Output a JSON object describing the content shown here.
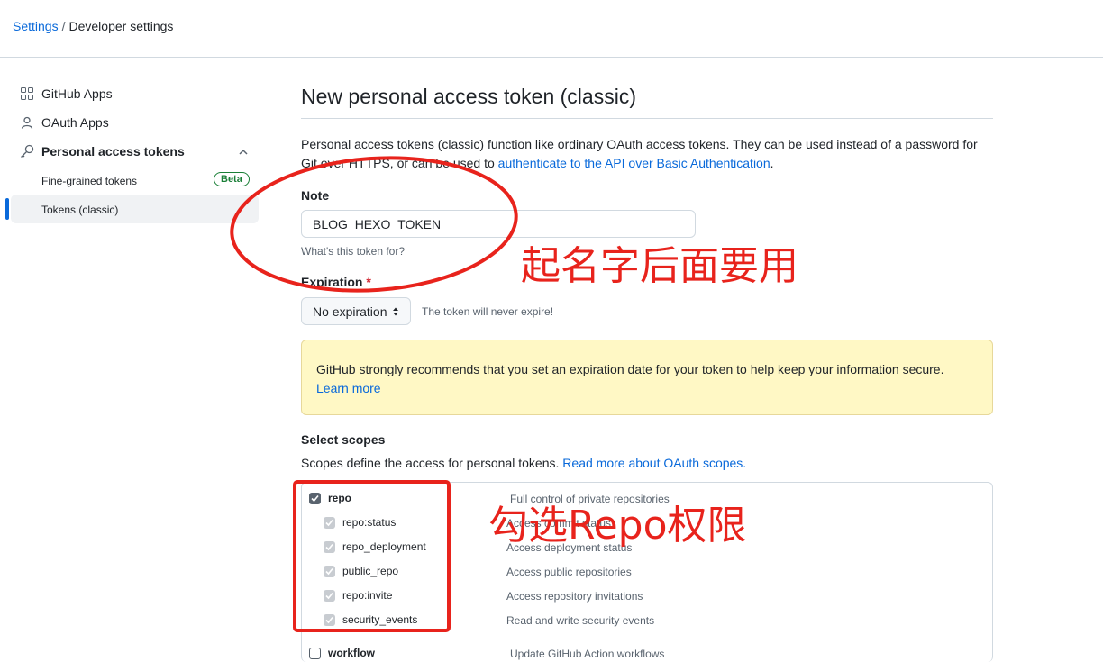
{
  "breadcrumb": {
    "root": "Settings",
    "separator": "/",
    "current": "Developer settings"
  },
  "sidebar": {
    "items": [
      {
        "label": "GitHub Apps",
        "icon": "apps-grid-icon"
      },
      {
        "label": "OAuth Apps",
        "icon": "person-icon"
      },
      {
        "label": "Personal access tokens",
        "icon": "key-icon"
      }
    ],
    "sub_items": [
      {
        "label": "Fine-grained tokens",
        "badge": "Beta"
      },
      {
        "label": "Tokens (classic)",
        "active": true
      }
    ]
  },
  "page": {
    "title": "New personal access token (classic)",
    "intro_text": "Personal access tokens (classic) function like ordinary OAuth access tokens. They can be used instead of a password for Git over HTTPS, or can be used to",
    "intro_link": "authenticate to the API over Basic Authentication",
    "intro_end": "."
  },
  "note": {
    "label": "Note",
    "value": "BLOG_HEXO_TOKEN",
    "hint": "What's this token for?"
  },
  "expiration": {
    "label": "Expiration",
    "required_mark": "*",
    "selected": "No expiration",
    "hint": "The token will never expire!"
  },
  "warning": {
    "text": "GitHub strongly recommends that you set an expiration date for your token to help keep your information secure.",
    "link": "Learn more"
  },
  "scopes": {
    "heading": "Select scopes",
    "description": "Scopes define the access for personal tokens.",
    "link": "Read more about OAuth scopes.",
    "items": [
      {
        "name": "repo",
        "desc": "Full control of private repositories",
        "checked": true
      },
      {
        "name": "repo:status",
        "desc": "Access commit status",
        "checked": true,
        "child": true
      },
      {
        "name": "repo_deployment",
        "desc": "Access deployment status",
        "checked": true,
        "child": true
      },
      {
        "name": "public_repo",
        "desc": "Access public repositories",
        "checked": true,
        "child": true
      },
      {
        "name": "repo:invite",
        "desc": "Access repository invitations",
        "checked": true,
        "child": true
      },
      {
        "name": "security_events",
        "desc": "Read and write security events",
        "checked": true,
        "child": true
      },
      {
        "name": "workflow",
        "desc": "Update GitHub Action workflows",
        "checked": false
      }
    ]
  },
  "annotations": {
    "name_note": "起名字后面要用",
    "repo_note": "勾选Repo权限",
    "color": "#e8231c"
  }
}
